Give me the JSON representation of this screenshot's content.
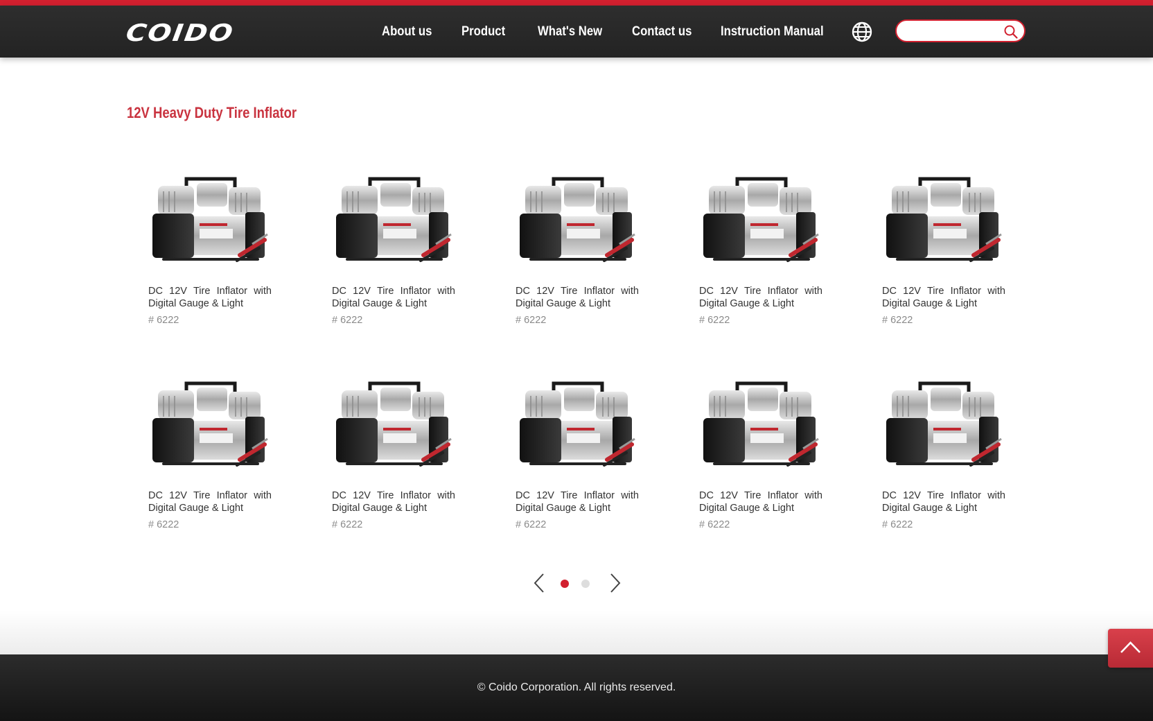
{
  "brand": {
    "logo_text": "COIDO",
    "accent": "#d2202f"
  },
  "nav": {
    "items": [
      {
        "label": "About us"
      },
      {
        "label": "Product"
      },
      {
        "label": "What's New"
      },
      {
        "label": "Contact us"
      },
      {
        "label": "Instruction Manual"
      }
    ],
    "language_icon": "globe-icon"
  },
  "search": {
    "placeholder": "",
    "value": "",
    "icon": "search-icon"
  },
  "page": {
    "title": "12V Heavy Duty Tire Inflator"
  },
  "products": [
    {
      "name": "DC 12V Tire Inflator with Digital Gauge & Light",
      "code": "# 6222"
    },
    {
      "name": "DC 12V Tire Inflator with Digital Gauge & Light",
      "code": "# 6222"
    },
    {
      "name": "DC 12V Tire Inflator with Digital Gauge & Light",
      "code": "# 6222"
    },
    {
      "name": "DC 12V Tire Inflator with Digital Gauge & Light",
      "code": "# 6222"
    },
    {
      "name": "DC 12V Tire Inflator with Digital Gauge & Light",
      "code": "# 6222"
    },
    {
      "name": "DC 12V Tire Inflator with Digital Gauge & Light",
      "code": "# 6222"
    },
    {
      "name": "DC 12V Tire Inflator with Digital Gauge & Light",
      "code": "# 6222"
    },
    {
      "name": "DC 12V Tire Inflator with Digital Gauge & Light",
      "code": "# 6222"
    },
    {
      "name": "DC 12V Tire Inflator with Digital Gauge & Light",
      "code": "# 6222"
    },
    {
      "name": "DC 12V Tire Inflator with Digital Gauge & Light",
      "code": "# 6222"
    }
  ],
  "pagination": {
    "pages": 2,
    "current": 1,
    "prev_icon": "chevron-left-icon",
    "next_icon": "chevron-right-icon"
  },
  "footer": {
    "copyright": "© Coido Corporation. All rights reserved."
  },
  "back_to_top_icon": "chevron-up-icon"
}
